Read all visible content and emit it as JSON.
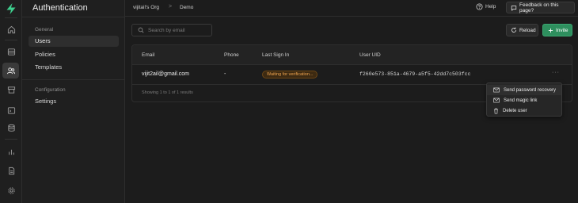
{
  "app": {
    "section_title": "Authentication"
  },
  "rail": {
    "icons": [
      "logo-icon",
      "home-icon",
      "table-editor-icon",
      "users-icon",
      "storage-icon",
      "sql-terminal-icon",
      "database-icon",
      "reports-icon",
      "docs-icon",
      "settings-icon"
    ],
    "brand_color": "#3ecf8e"
  },
  "sidebar": {
    "groups": [
      {
        "label": "General",
        "items": [
          {
            "label": "Users"
          },
          {
            "label": "Policies"
          },
          {
            "label": "Templates"
          }
        ]
      },
      {
        "label": "Configuration",
        "items": [
          {
            "label": "Settings"
          }
        ]
      }
    ],
    "active_item": "Users"
  },
  "topbar": {
    "org": "vijitail's Org",
    "separator": ">",
    "project": "Demo",
    "help_label": "Help",
    "feedback_label": "Feedback on this page?"
  },
  "toolbar": {
    "search_placeholder": "Search by email",
    "reload_label": "Reload",
    "invite_label": "Invite",
    "invite_color": "#2e8f5e"
  },
  "table": {
    "columns": [
      "Email",
      "Phone",
      "Last Sign In",
      "User UID"
    ],
    "rows": [
      {
        "email": "vijit2ail@gmail.com",
        "phone": "-",
        "last_sign_in": "Waiting for verification...",
        "uid": "f260e573-851a-4679-a5f5-42dd7c503fcc",
        "more": "···"
      }
    ],
    "footer": "Showing 1 to 1 of 1 results",
    "status_color": "#f0a550"
  },
  "context_menu": {
    "items": [
      {
        "label": "Send password recovery",
        "icon": "mail-icon"
      },
      {
        "label": "Send magic link",
        "icon": "mail-icon"
      },
      {
        "label": "Delete user",
        "icon": "trash-icon"
      }
    ]
  }
}
